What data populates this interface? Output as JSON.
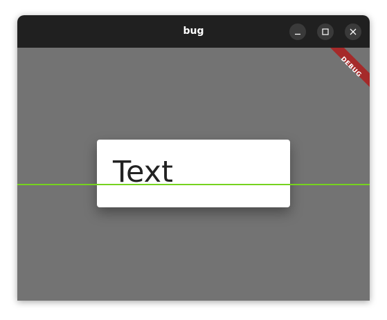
{
  "window": {
    "title": "bug",
    "controls": {
      "minimize_icon": "minimize-icon",
      "maximize_icon": "maximize-icon",
      "close_icon": "close-icon"
    }
  },
  "app": {
    "banner_label": "DEBUG",
    "card_text": "Text"
  },
  "colors": {
    "titlebar": "#202020",
    "background": "#737373",
    "card": "#ffffff",
    "baseline": "#76d31e",
    "banner": "#a52a2a"
  }
}
